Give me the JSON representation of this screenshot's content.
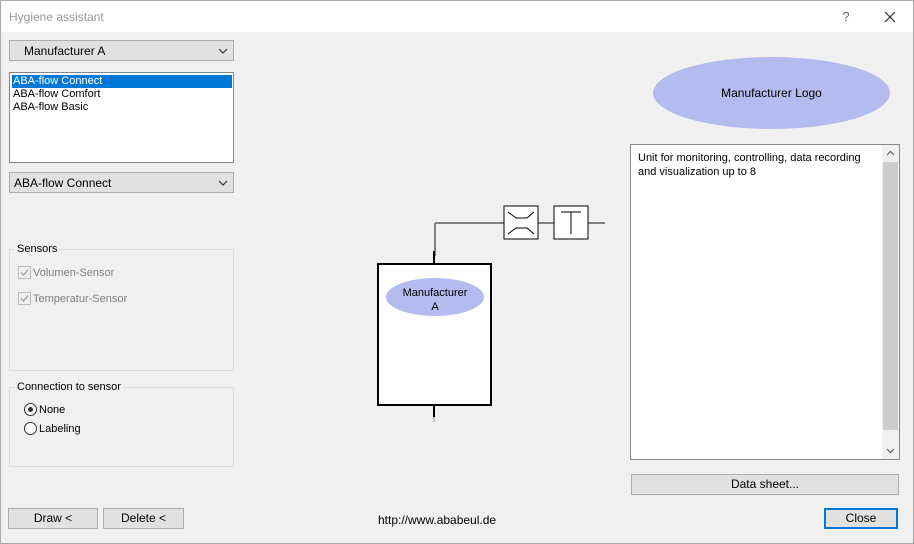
{
  "window": {
    "title": "Hygiene assistant",
    "help_glyph": "?"
  },
  "manufacturer_select": {
    "value": "Manufacturer A"
  },
  "product_list": {
    "items": [
      {
        "label": "ABA-flow Connect",
        "selected": true
      },
      {
        "label": "ABA-flow Comfort",
        "selected": false
      },
      {
        "label": "ABA-flow Basic",
        "selected": false
      }
    ]
  },
  "product_select": {
    "value": "ABA-flow Connect"
  },
  "sensors": {
    "title": "Sensors",
    "items": [
      {
        "label": "Volumen-Sensor",
        "checked": true,
        "enabled": false
      },
      {
        "label": "Temperatur-Sensor",
        "checked": true,
        "enabled": false
      }
    ]
  },
  "connection": {
    "title": "Connection to sensor",
    "options": [
      {
        "label": "None",
        "selected": true
      },
      {
        "label": "Labeling",
        "selected": false
      }
    ]
  },
  "diagram": {
    "device_label_line1": "Manufacturer",
    "device_label_line2": "A"
  },
  "logo": {
    "text": "Manufacturer Logo"
  },
  "description": {
    "text": "Unit for monitoring, controlling, data recording and visualization up to 8"
  },
  "buttons": {
    "draw": "Draw <",
    "delete": "Delete <",
    "data_sheet": "Data sheet...",
    "close": "Close"
  },
  "footer": {
    "url": "http://www.ababeul.de"
  },
  "colors": {
    "accent": "#0078d7",
    "ellipse_fill": "#b4bbee"
  }
}
